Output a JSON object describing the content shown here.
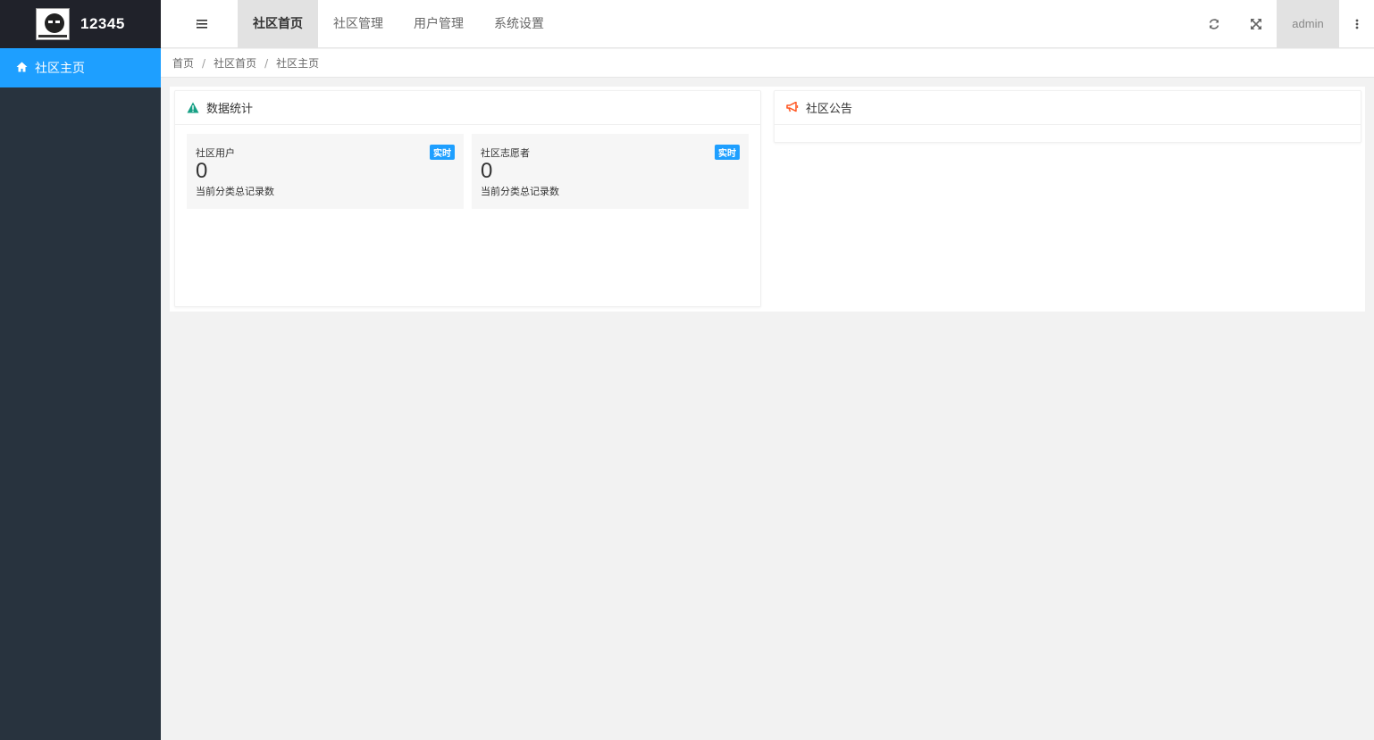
{
  "app": {
    "title": "12345"
  },
  "sidebar": {
    "items": [
      {
        "label": "社区主页",
        "icon": "home-icon",
        "active": true
      }
    ]
  },
  "header": {
    "tabs": [
      {
        "label": "社区首页",
        "active": true
      },
      {
        "label": "社区管理",
        "active": false
      },
      {
        "label": "用户管理",
        "active": false
      },
      {
        "label": "系统设置",
        "active": false
      }
    ],
    "user": "admin",
    "icons": [
      "menu-toggle-icon",
      "refresh-icon",
      "fullscreen-icon",
      "more-vertical-icon"
    ]
  },
  "breadcrumb": {
    "items": [
      "首页",
      "社区首页",
      "社区主页"
    ],
    "separator": "/"
  },
  "stats_card": {
    "title": "数据统计",
    "icon": "warning-icon",
    "stats": [
      {
        "title": "社区用户",
        "badge": "实时",
        "value": "0",
        "desc": "当前分类总记录数"
      },
      {
        "title": "社区志愿者",
        "badge": "实时",
        "value": "0",
        "desc": "当前分类总记录数"
      }
    ]
  },
  "notice_card": {
    "title": "社区公告",
    "icon": "megaphone-icon"
  },
  "colors": {
    "sidebar_bg": "#28333e",
    "logo_bg": "#20222a",
    "accent": "#1e9fff",
    "warning_icon": "#16a085",
    "megaphone_icon": "#ff5722"
  }
}
